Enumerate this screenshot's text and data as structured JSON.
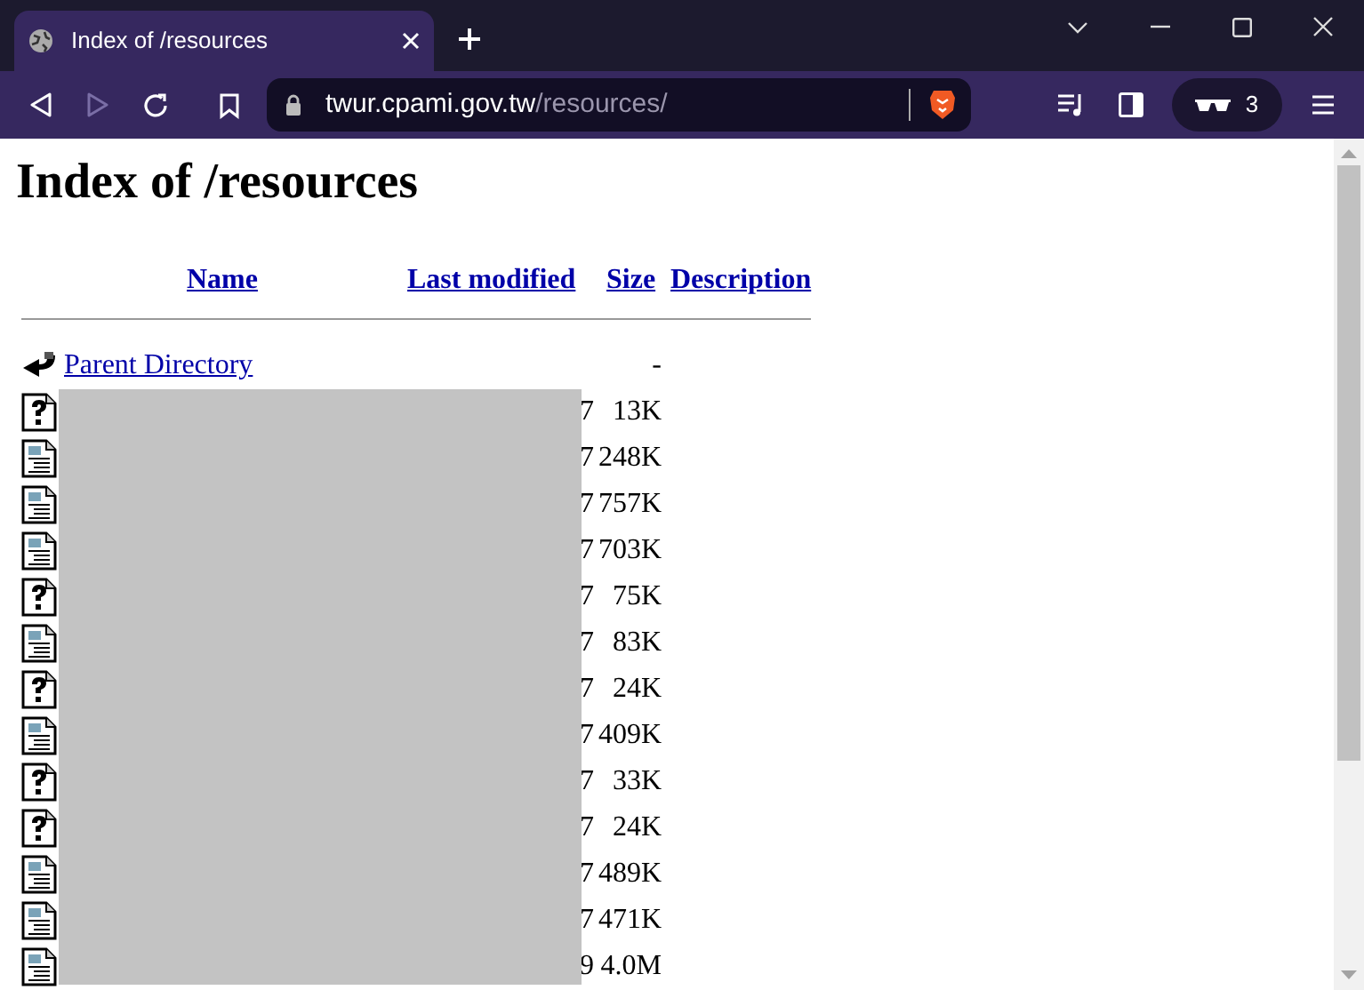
{
  "browser": {
    "tabs": [
      {
        "title": "Index of /resources",
        "selected": true
      }
    ],
    "back_button": {
      "disabled": false
    },
    "forward_button": {
      "disabled": true
    },
    "address": {
      "host": "twur.cpami.gov.tw",
      "path": "/resources/"
    },
    "private_window_badge": "3"
  },
  "page": {
    "heading": "Index of /resources",
    "columns": [
      "Name",
      "Last modified",
      "Size",
      "Description"
    ],
    "parent": {
      "label": "Parent Directory",
      "size": "-"
    },
    "rows": [
      {
        "kind": "unknown",
        "modified": "7",
        "size": "13K"
      },
      {
        "kind": "text",
        "modified": "7",
        "size": "248K"
      },
      {
        "kind": "text",
        "modified": "7",
        "size": "757K"
      },
      {
        "kind": "text",
        "modified": "7",
        "size": "703K"
      },
      {
        "kind": "unknown",
        "modified": "7",
        "size": "75K"
      },
      {
        "kind": "text",
        "modified": "7",
        "size": "83K"
      },
      {
        "kind": "unknown",
        "modified": "7",
        "size": "24K"
      },
      {
        "kind": "text",
        "modified": "7",
        "size": "409K"
      },
      {
        "kind": "unknown",
        "modified": "7",
        "size": "33K"
      },
      {
        "kind": "unknown",
        "modified": "7",
        "size": "24K"
      },
      {
        "kind": "text",
        "modified": "7",
        "size": "489K"
      },
      {
        "kind": "text",
        "modified": "7",
        "size": "471K"
      },
      {
        "kind": "text",
        "modified": "9",
        "size": "4.0M"
      }
    ]
  }
}
